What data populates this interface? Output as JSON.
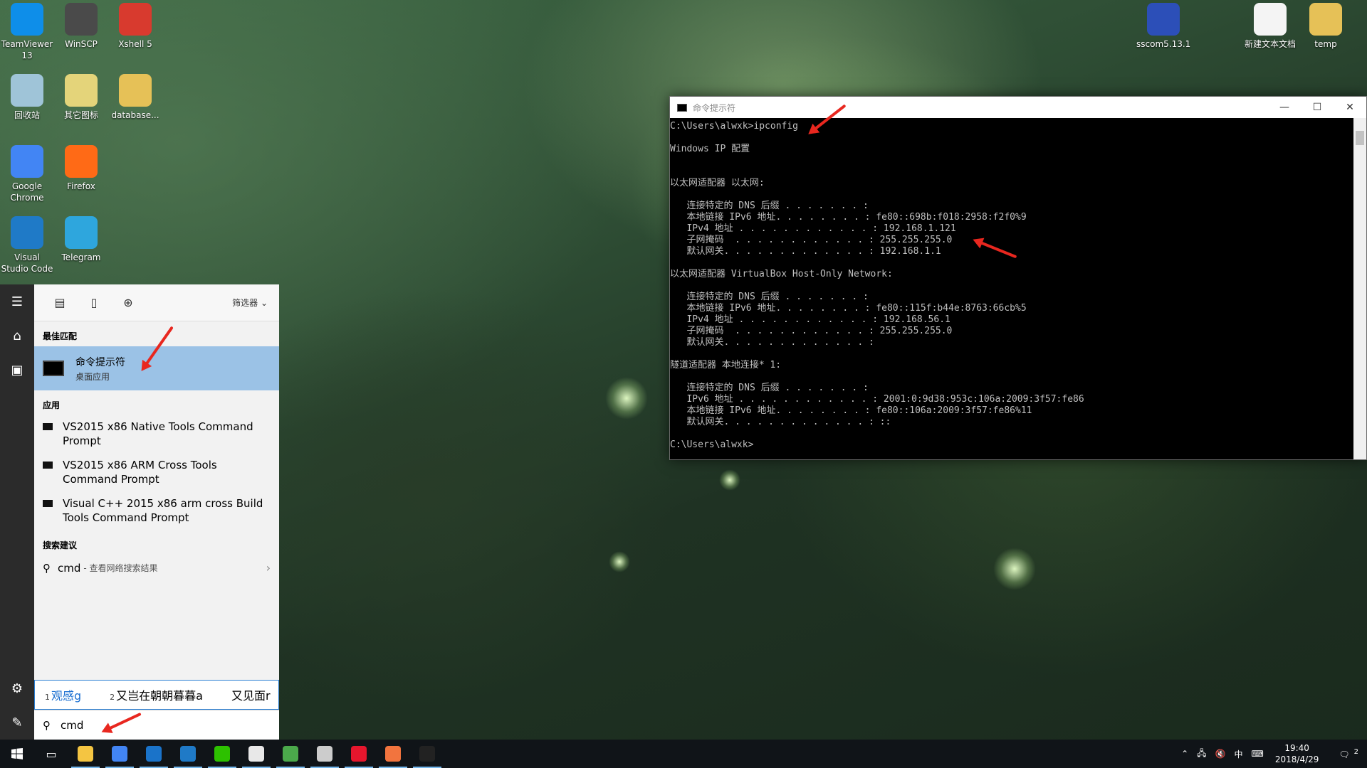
{
  "desktop_icons": [
    {
      "label": "TeamViewer 13",
      "icon": "teamviewer-icon",
      "color": "#0e8ee9"
    },
    {
      "label": "WinSCP",
      "icon": "winscp-icon",
      "color": "#4a4a4a"
    },
    {
      "label": "Xshell 5",
      "icon": "xshell-icon",
      "color": "#d83a2e"
    },
    {
      "label": "回收站",
      "icon": "recycle-bin-icon",
      "color": "#9fc4d8"
    },
    {
      "label": "其它图标",
      "icon": "other-icons-folder-icon",
      "color": "#e4d47a"
    },
    {
      "label": "database...",
      "icon": "database-folder-icon",
      "color": "#e6c157"
    },
    {
      "label": "Google Chrome",
      "icon": "chrome-icon",
      "color": "#4285f4"
    },
    {
      "label": "Firefox",
      "icon": "firefox-icon",
      "color": "#ff6a16"
    },
    {
      "label": "Visual Studio Code",
      "icon": "vscode-icon",
      "color": "#1f7ac7"
    },
    {
      "label": "Telegram",
      "icon": "telegram-icon",
      "color": "#2ea6dd"
    },
    {
      "label": "sscom5.13.1",
      "icon": "sscom-icon",
      "color": "#2c4fb8"
    },
    {
      "label": "新建文本文档",
      "icon": "text-document-icon",
      "color": "#f4f4f4"
    },
    {
      "label": "temp",
      "icon": "temp-folder-icon",
      "color": "#e6c157"
    }
  ],
  "cmd_window": {
    "title": "命令提示符",
    "minimize": "—",
    "maximize": "☐",
    "close": "✕",
    "output": "C:\\Users\\alwxk>ipconfig\n\nWindows IP 配置\n\n\n以太网适配器 以太网:\n\n   连接特定的 DNS 后缀 . . . . . . . :\n   本地链接 IPv6 地址. . . . . . . . : fe80::698b:f018:2958:f2f0%9\n   IPv4 地址 . . . . . . . . . . . . : 192.168.1.121\n   子网掩码  . . . . . . . . . . . . : 255.255.255.0\n   默认网关. . . . . . . . . . . . . : 192.168.1.1\n\n以太网适配器 VirtualBox Host-Only Network:\n\n   连接特定的 DNS 后缀 . . . . . . . :\n   本地链接 IPv6 地址. . . . . . . . : fe80::115f:b44e:8763:66cb%5\n   IPv4 地址 . . . . . . . . . . . . : 192.168.56.1\n   子网掩码  . . . . . . . . . . . . : 255.255.255.0\n   默认网关. . . . . . . . . . . . . :\n\n隧道适配器 本地连接* 1:\n\n   连接特定的 DNS 后缀 . . . . . . . :\n   IPv6 地址 . . . . . . . . . . . . : 2001:0:9d38:953c:106a:2009:3f57:fe86\n   本地链接 IPv6 地址. . . . . . . . : fe80::106a:2009:3f57:fe86%11\n   默认网关. . . . . . . . . . . . . : ::\n\nC:\\Users\\alwxk>"
  },
  "start_menu": {
    "filter_label": "筛选器",
    "best_match_header": "最佳匹配",
    "best_match": {
      "title": "命令提示符",
      "subtitle": "桌面应用"
    },
    "apps_header": "应用",
    "apps": [
      {
        "label": "VS2015 x86 Native Tools Command Prompt"
      },
      {
        "label": "VS2015 x86 ARM Cross Tools Command Prompt"
      },
      {
        "label": "Visual C++ 2015 x86 arm cross Build Tools Command Prompt"
      }
    ],
    "suggest_header": "搜索建议",
    "suggestion": {
      "term": "cmd",
      "hint": "- 查看网络搜索结果"
    },
    "ime_candidates": [
      {
        "num": "1",
        "text": "观感g"
      },
      {
        "num": "2",
        "text": "又岂在朝朝暮暮a"
      },
      {
        "num": "",
        "text": "又见面r"
      }
    ],
    "search_value": "cmd"
  },
  "taskbar": {
    "apps": [
      {
        "name": "taskbar-explorer",
        "color": "#f4c542"
      },
      {
        "name": "taskbar-chrome",
        "color": "#4285f4"
      },
      {
        "name": "taskbar-app-blue",
        "color": "#1a73c9"
      },
      {
        "name": "taskbar-vscode",
        "color": "#1f7ac7"
      },
      {
        "name": "taskbar-wechat",
        "color": "#2dc100"
      },
      {
        "name": "taskbar-qq",
        "color": "#e8e8e8"
      },
      {
        "name": "taskbar-evernote",
        "color": "#4ba94b"
      },
      {
        "name": "taskbar-remote",
        "color": "#cccccc"
      },
      {
        "name": "taskbar-weibo",
        "color": "#e6162d"
      },
      {
        "name": "taskbar-ppt",
        "color": "#f2743e"
      },
      {
        "name": "taskbar-cmd",
        "color": "#222222"
      }
    ],
    "ime_indicator": "中",
    "time": "19:40",
    "date": "2018/4/29",
    "notification_count": "2"
  }
}
